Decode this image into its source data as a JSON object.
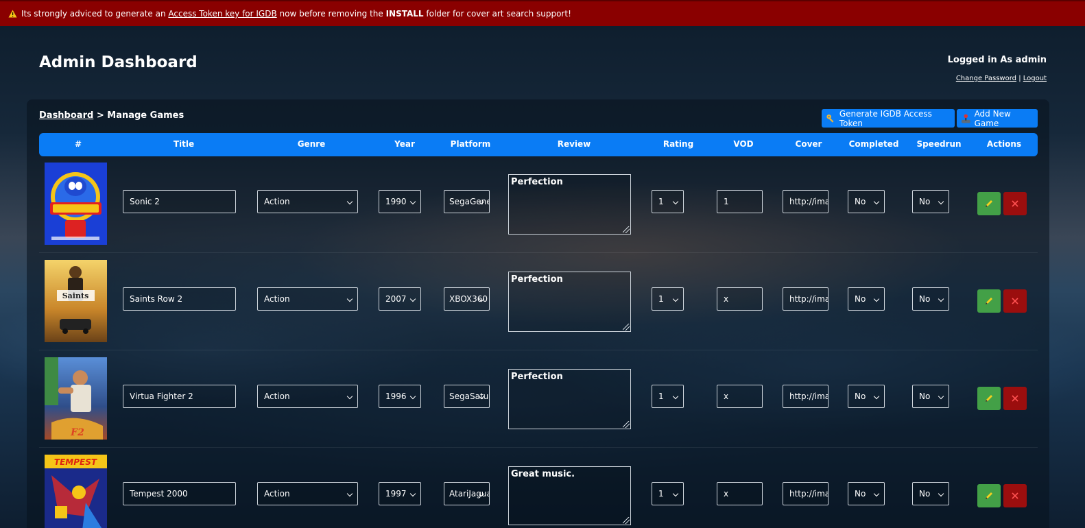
{
  "alert": {
    "text_before": "Its strongly adviced to generate an ",
    "link": "Access Token key for IGDB",
    "text_mid": " now before removing the ",
    "bold": "INSTALL",
    "text_after": " folder for cover art search support!"
  },
  "header": {
    "title": "Admin Dashboard",
    "logged_in_label": "Logged in As",
    "username": "admin",
    "change_password": "Change Password",
    "separator": "|",
    "logout": "Logout"
  },
  "breadcrumb": {
    "root": "Dashboard",
    "separator": ">",
    "current": "Manage Games"
  },
  "toolbar": {
    "generate_token": "Generate IGDB Access Token",
    "add_game": "Add New Game"
  },
  "columns": [
    "#",
    "Title",
    "Genre",
    "Year",
    "Platform",
    "Review",
    "Rating",
    "VOD",
    "Cover",
    "Completed",
    "Speedrun",
    "Actions"
  ],
  "games": [
    {
      "title": "Sonic 2",
      "genre": "Action",
      "year": "1990",
      "platform": "SegaGenesis",
      "review": "Perfection",
      "rating": "1",
      "vod": "1",
      "cover": "http://images.igdb.com",
      "completed": "No",
      "speedrun": "No",
      "cover_art": "sonic"
    },
    {
      "title": "Saints Row 2",
      "genre": "Action",
      "year": "2007",
      "platform": "XBOX360",
      "review": "Perfection",
      "rating": "1",
      "vod": "x",
      "cover": "http://images.igdb.com",
      "completed": "No",
      "speedrun": "No",
      "cover_art": "saints"
    },
    {
      "title": "Virtua Fighter 2",
      "genre": "Action",
      "year": "1996",
      "platform": "SegaSaturn",
      "review": "Perfection",
      "rating": "1",
      "vod": "x",
      "cover": "http://images.igdb.com",
      "completed": "No",
      "speedrun": "No",
      "cover_art": "virtua"
    },
    {
      "title": "Tempest 2000",
      "genre": "Action",
      "year": "1997",
      "platform": "AtariJaguar",
      "review": "Great music.",
      "rating": "1",
      "vod": "x",
      "cover": "http://images.igdb.com",
      "completed": "No",
      "speedrun": "No",
      "cover_art": "tempest"
    }
  ],
  "colors": {
    "alert_bg": "#8a0000",
    "accent": "#0a7cf5",
    "edit": "#43a047",
    "delete": "#9b0e0e"
  },
  "icons": {
    "warning": "warning-icon",
    "key": "key-icon",
    "joystick": "joystick-icon",
    "edit": "pencil-icon",
    "delete": "close-icon"
  }
}
